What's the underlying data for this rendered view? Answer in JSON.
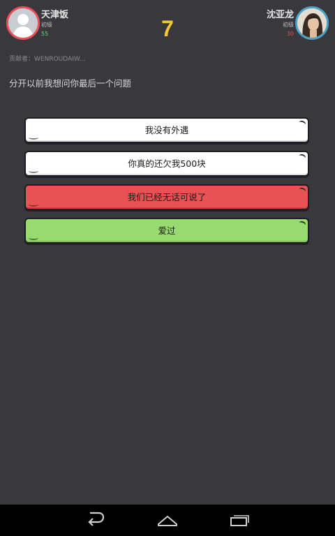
{
  "player_left": {
    "name": "天津饭",
    "level": "初级",
    "score": "55"
  },
  "player_right": {
    "name": "沈亚龙",
    "level": "初级",
    "score": "30"
  },
  "timer": "7",
  "contributor": "贡献者：WENROUDAIW...",
  "question": "分开以前我想问你最后一个问题",
  "answers": [
    {
      "label": "我没有外遇",
      "color": "#ffffff"
    },
    {
      "label": "你真的还欠我500块",
      "color": "#ffffff"
    },
    {
      "label": "我们已经无话可说了",
      "color": "#e95252"
    },
    {
      "label": "爱过",
      "color": "#97db6e"
    }
  ],
  "nav": {
    "back_icon": "back-icon",
    "home_icon": "home-icon",
    "recents_icon": "recent-apps-icon"
  }
}
